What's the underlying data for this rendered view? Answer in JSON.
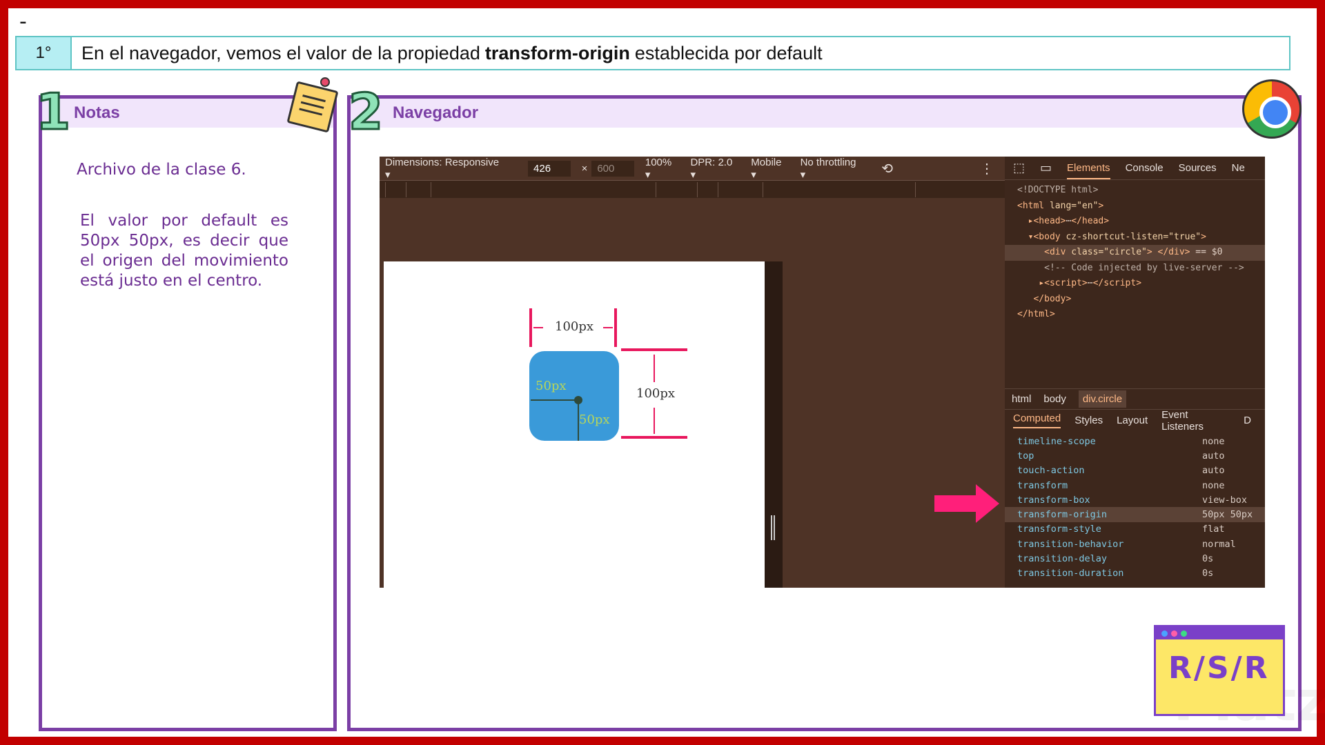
{
  "slide": {
    "dash": "-",
    "step_number": "1°",
    "step_text_before": "En el navegador, vemos el valor de la propiedad",
    "step_text_bold": "transform-origin",
    "step_text_after": "establecida por default"
  },
  "notes_panel": {
    "number": "1",
    "title": "Notas",
    "paragraph_1": "Archivo de la clase 6.",
    "paragraph_2": "El valor por default es 50px 50px, es decir que el origen del movimiento está justo en el centro."
  },
  "browser_panel": {
    "number": "2",
    "title": "Navegador"
  },
  "device_toolbar": {
    "dimensions": "Dimensions: Responsive ▾",
    "width": "426",
    "times": "×",
    "height": "600",
    "zoom": "100% ▾",
    "dpr": "DPR: 2.0 ▾",
    "mode": "Mobile ▾",
    "throttling": "No throttling ▾",
    "rotate_icon": "⟲",
    "more_icon": "⋮"
  },
  "diagram": {
    "width_label": "100px",
    "height_label": "100px",
    "origin_x_label": "50px",
    "origin_y_label": "50px",
    "box_color": "#3a9ad9",
    "dimension_color": "#e8175d"
  },
  "devtools": {
    "inspect_icon": "⬚",
    "device_icon": "▭",
    "tabs": [
      "Elements",
      "Console",
      "Sources",
      "Ne"
    ],
    "active_tab": "Elements",
    "breadcrumbs": [
      "html",
      "body",
      "div.circle"
    ],
    "subtabs": [
      "Computed",
      "Styles",
      "Layout",
      "Event Listeners",
      "D"
    ],
    "computed": [
      {
        "name": "timeline-scope",
        "value": "none"
      },
      {
        "name": "top",
        "value": "auto"
      },
      {
        "name": "touch-action",
        "value": "auto"
      },
      {
        "name": "transform",
        "value": "none"
      },
      {
        "name": "transform-box",
        "value": "view-box"
      },
      {
        "name": "transform-origin",
        "value": "50px 50px"
      },
      {
        "name": "transform-style",
        "value": "flat"
      },
      {
        "name": "transition-behavior",
        "value": "normal"
      },
      {
        "name": "transition-delay",
        "value": "0s"
      },
      {
        "name": "transition-duration",
        "value": "0s"
      }
    ]
  },
  "logo": {
    "text": "R/S/R"
  }
}
